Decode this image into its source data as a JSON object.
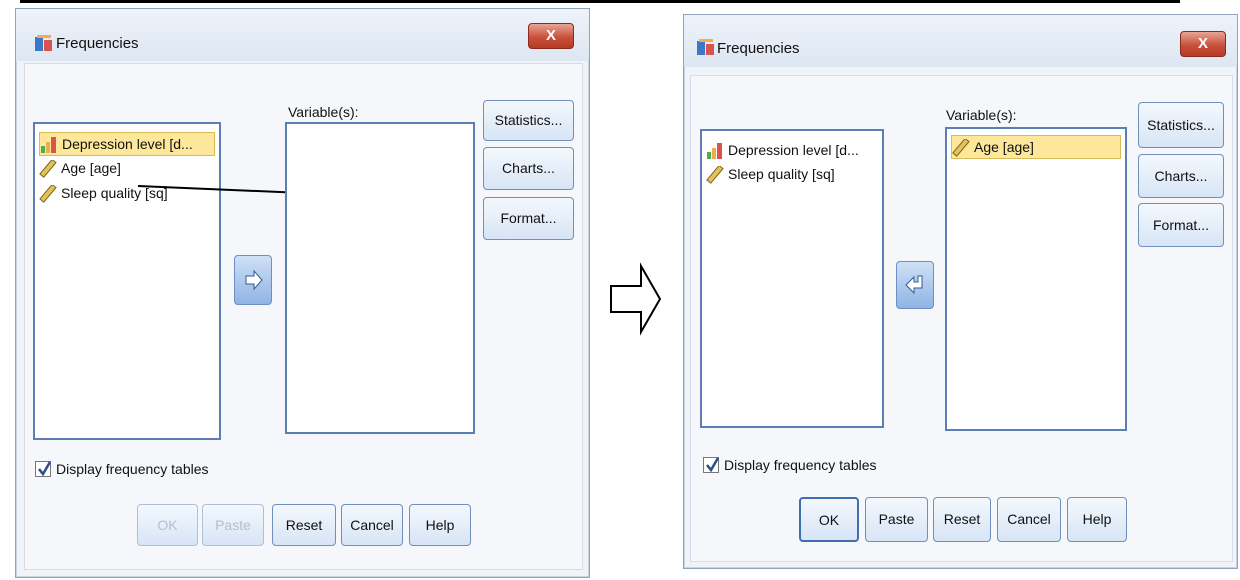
{
  "left_dialog": {
    "title": "Frequencies",
    "close_label": "X",
    "source_items": [
      {
        "label": "Depression level [d...",
        "icon": "ordinal-bar-icon",
        "selected": true
      },
      {
        "label": "Age [age]",
        "icon": "scale-ruler-icon",
        "selected": false
      },
      {
        "label": "Sleep quality [sq]",
        "icon": "scale-ruler-icon",
        "selected": false
      }
    ],
    "variables_label": "Variable(s):",
    "target_items": [],
    "move_button_icon": "arrow-right-icon",
    "side_buttons": [
      "Statistics...",
      "Charts...",
      "Format..."
    ],
    "checkbox_label": "Display frequency tables",
    "checkbox_checked": true,
    "bottom_buttons": [
      {
        "label": "OK",
        "enabled": false
      },
      {
        "label": "Paste",
        "enabled": false
      },
      {
        "label": "Reset",
        "enabled": true
      },
      {
        "label": "Cancel",
        "enabled": true
      },
      {
        "label": "Help",
        "enabled": true
      }
    ]
  },
  "transition_icon": "hollow-arrow-right-icon",
  "right_dialog": {
    "title": "Frequencies",
    "close_label": "X",
    "source_items": [
      {
        "label": "Depression level [d...",
        "icon": "ordinal-bar-icon",
        "selected": false
      },
      {
        "label": "Sleep quality [sq]",
        "icon": "scale-ruler-icon",
        "selected": false
      }
    ],
    "variables_label": "Variable(s):",
    "target_items": [
      {
        "label": "Age [age]",
        "icon": "scale-ruler-icon",
        "selected": true
      }
    ],
    "move_button_icon": "arrow-left-icon",
    "side_buttons": [
      "Statistics...",
      "Charts...",
      "Format..."
    ],
    "checkbox_label": "Display frequency tables",
    "checkbox_checked": true,
    "bottom_buttons": [
      {
        "label": "OK",
        "enabled": true
      },
      {
        "label": "Paste",
        "enabled": true
      },
      {
        "label": "Reset",
        "enabled": true
      },
      {
        "label": "Cancel",
        "enabled": true
      },
      {
        "label": "Help",
        "enabled": true
      }
    ]
  }
}
